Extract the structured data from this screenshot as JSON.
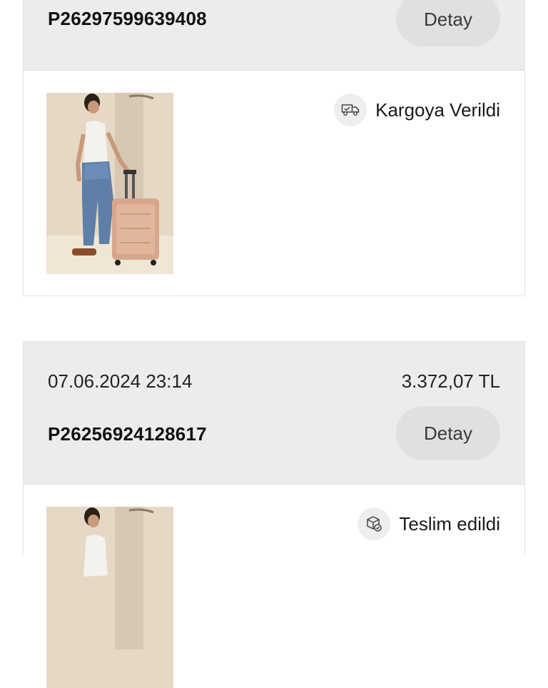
{
  "orders": [
    {
      "order_no": "P26297599639408",
      "detail_label": "Detay",
      "status": "Kargoya Verildi",
      "status_icon": "truck-icon"
    },
    {
      "date": "07.06.2024 23:14",
      "price": "3.372,07 TL",
      "order_no": "P26256924128617",
      "detail_label": "Detay",
      "status": "Teslim edildi",
      "status_icon": "package-delivered-icon"
    }
  ]
}
